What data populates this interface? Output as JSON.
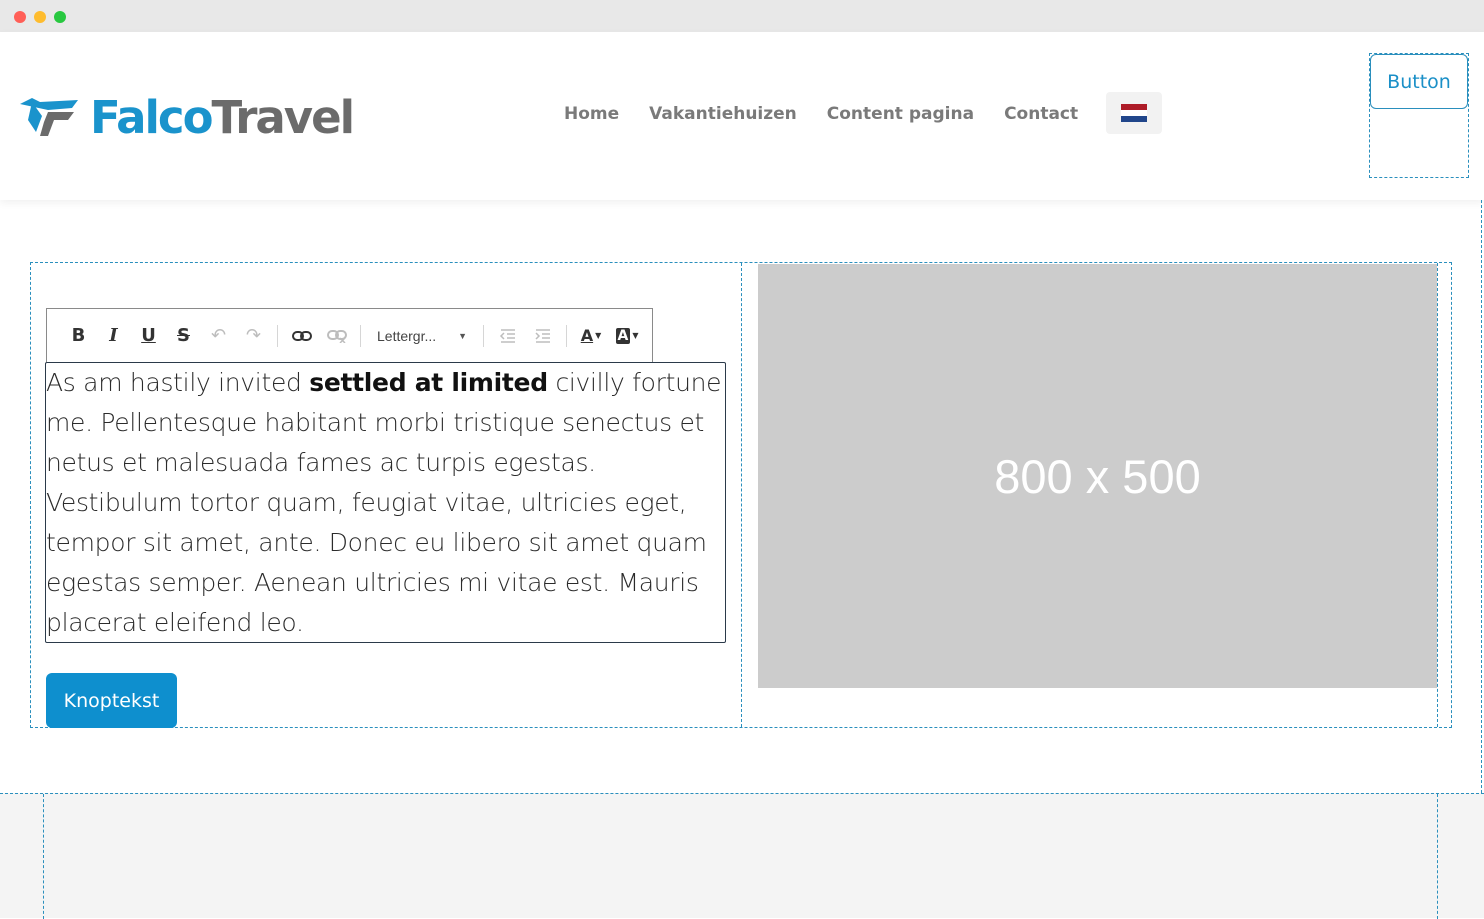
{
  "window": {
    "controls": [
      "close",
      "minimize",
      "maximize"
    ]
  },
  "header": {
    "logo": {
      "part1": "Falco",
      "part2": "Travel",
      "icon": "falcon-wing-icon"
    },
    "nav": [
      {
        "label": "Home"
      },
      {
        "label": "Vakantiehuizen"
      },
      {
        "label": "Content pagina"
      },
      {
        "label": "Contact"
      }
    ],
    "language": {
      "icon": "netherlands-flag-icon",
      "colors": [
        "#ae1c28",
        "#ffffff",
        "#21468b"
      ]
    },
    "button_label": "Button"
  },
  "toolbar": {
    "bold": "B",
    "italic": "I",
    "underline": "U",
    "strike": "S",
    "font_select": "Lettergr...",
    "text_color": "A",
    "bg_color": "A"
  },
  "editor": {
    "text_before": "As am hastily invited ",
    "text_bold": "settled at limited",
    "text_after": " civilly fortune me. Pellentesque habitant morbi tristique senectus et netus et malesuada fames ac turpis egestas. Vestibulum tortor quam, feugiat vitae, ultricies eget, tempor sit amet, ante. Donec eu libero sit amet quam egestas semper. Aenean ultricies mi vitae est. Mauris placerat eleifend leo."
  },
  "cta_label": "Knoptekst",
  "image_placeholder": {
    "label": "800 x 500"
  },
  "colors": {
    "brand_blue": "#1a93cc",
    "brand_gray": "#6b6b6b",
    "cta": "#0e8fce",
    "guide": "#2a8fbd"
  }
}
